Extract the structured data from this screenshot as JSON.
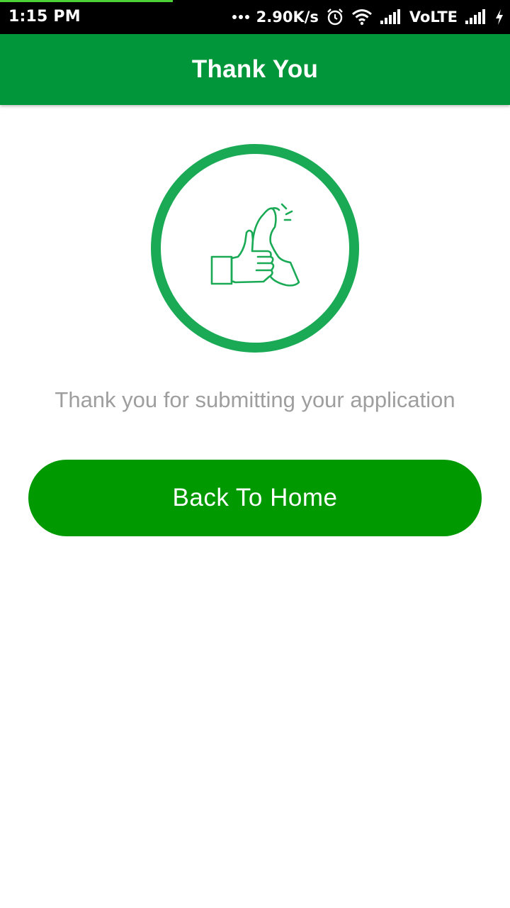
{
  "status_bar": {
    "time": "1:15 PM",
    "network_speed": "2.90K/s",
    "network_label": "VoLTE",
    "icons": [
      "more-dots-icon",
      "alarm-icon",
      "wifi-icon",
      "signal-icon",
      "signal-icon-2",
      "charging-icon"
    ]
  },
  "app_bar": {
    "title": "Thank You"
  },
  "main": {
    "emblem_icon": "thumbs-up-icon",
    "message": "Thank you for submitting your application",
    "home_button_label": "Back To Home"
  },
  "colors": {
    "primary_green": "#009639",
    "button_green": "#009a00",
    "emblem_green": "#1aaa55",
    "message_gray": "#9e9e9e"
  }
}
